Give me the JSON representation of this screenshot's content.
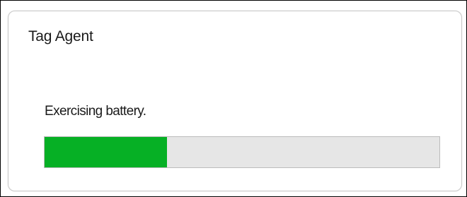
{
  "dialog": {
    "title": "Tag Agent",
    "status_text": "Exercising battery.",
    "progress": {
      "value_percent": 31,
      "fill_color": "#06b025",
      "track_color": "#e6e6e6"
    }
  }
}
